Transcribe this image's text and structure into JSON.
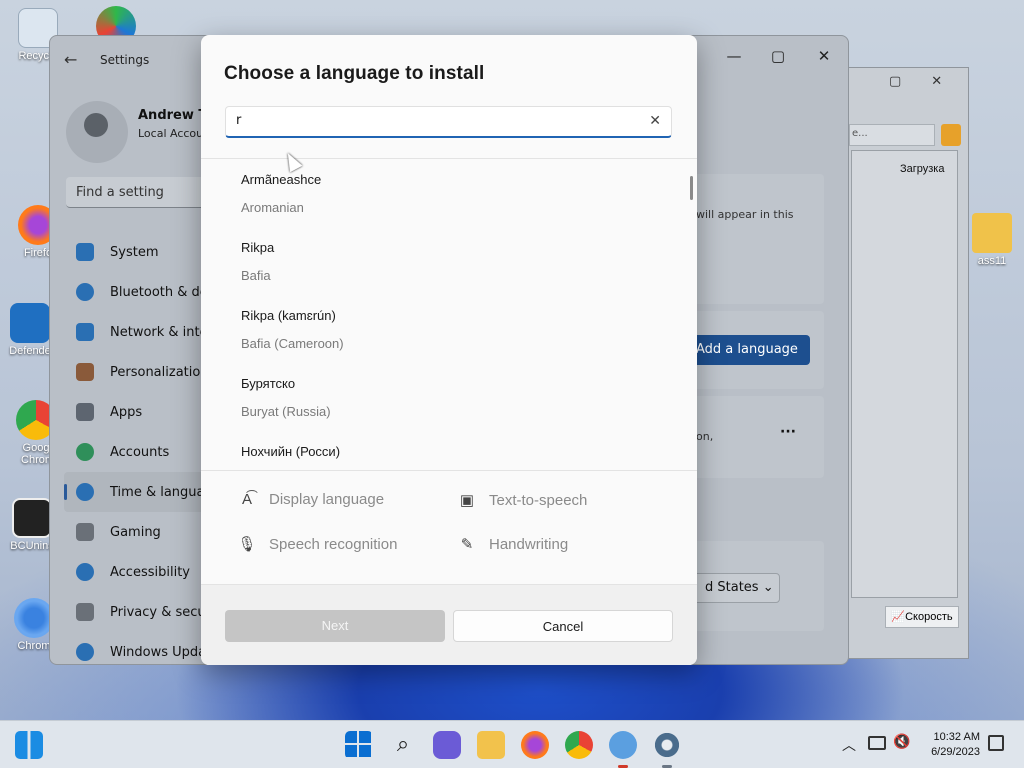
{
  "desktop": {
    "icons": [
      {
        "label": "Recycle"
      },
      {
        "label": "Firefo"
      },
      {
        "label": "Defende"
      },
      {
        "label": "Goog Chron"
      },
      {
        "label": "BCUnins"
      },
      {
        "label": "Chrom"
      },
      {
        "label": "ass11"
      }
    ]
  },
  "settings_window": {
    "title": "Settings",
    "back_icon": "arrow-left-icon",
    "user_name": "Andrew Ta",
    "account_type": "Local Accou",
    "search_placeholder": "Find a setting",
    "nav": [
      {
        "label": "System",
        "icon": "monitor-icon",
        "color": "#2a6fb3"
      },
      {
        "label": "Bluetooth & de",
        "icon": "bluetooth-icon",
        "color": "#2a6fb3"
      },
      {
        "label": "Network & inte",
        "icon": "wifi-icon",
        "color": "#2a6fb3"
      },
      {
        "label": "Personalization",
        "icon": "brush-icon",
        "color": "#8a5a3a"
      },
      {
        "label": "Apps",
        "icon": "apps-icon",
        "color": "#5d6570"
      },
      {
        "label": "Accounts",
        "icon": "person-icon",
        "color": "#2f8f5a"
      },
      {
        "label": "Time & langua",
        "icon": "globe-clock-icon",
        "color": "#2a6fb3"
      },
      {
        "label": "Gaming",
        "icon": "gamepad-icon",
        "color": "#6a7078"
      },
      {
        "label": "Accessibility",
        "icon": "accessibility-icon",
        "color": "#2a6fb3"
      },
      {
        "label": "Privacy & secu",
        "icon": "shield-icon",
        "color": "#6a7078"
      },
      {
        "label": "Windows Upda",
        "icon": "update-icon",
        "color": "#2a6fb3"
      }
    ],
    "selected_nav": "Time & langua",
    "card_text": "will appear in this",
    "add_language_label": "Add a language",
    "card2_text": "on,",
    "more_icon": "more-horizontal-icon",
    "region_value": "d States"
  },
  "file_window": {
    "search_hint": "е...",
    "column_label": "Загрузка",
    "speed_label": "Скорость"
  },
  "dialog": {
    "title": "Choose a language to install",
    "search_value": "r",
    "clear_icon": "close-icon",
    "languages": [
      {
        "native": "Armãneashce",
        "english": "Aromanian"
      },
      {
        "native": "Rikpa",
        "english": "Bafia"
      },
      {
        "native": "Rikpa (kamɛrún)",
        "english": "Bafia (Cameroon)"
      },
      {
        "native": "Бурятско",
        "english": "Buryat (Russia)"
      },
      {
        "native": "Нохчийн (Росси)",
        "english": ""
      }
    ],
    "features": [
      {
        "label": "Display language",
        "icon": "display-language-icon"
      },
      {
        "label": "Text-to-speech",
        "icon": "text-to-speech-icon"
      },
      {
        "label": "Speech recognition",
        "icon": "microphone-icon"
      },
      {
        "label": "Handwriting",
        "icon": "handwriting-icon"
      }
    ],
    "next_label": "Next",
    "cancel_label": "Cancel"
  },
  "taskbar": {
    "apps": [
      {
        "name": "start-icon"
      },
      {
        "name": "search-icon"
      },
      {
        "name": "chat-icon"
      },
      {
        "name": "file-explorer-icon"
      },
      {
        "name": "firefox-icon"
      },
      {
        "name": "chrome-icon"
      },
      {
        "name": "qbittorrent-icon"
      },
      {
        "name": "settings-gear-icon"
      }
    ],
    "time": "10:32 AM",
    "date": "6/29/2023"
  }
}
